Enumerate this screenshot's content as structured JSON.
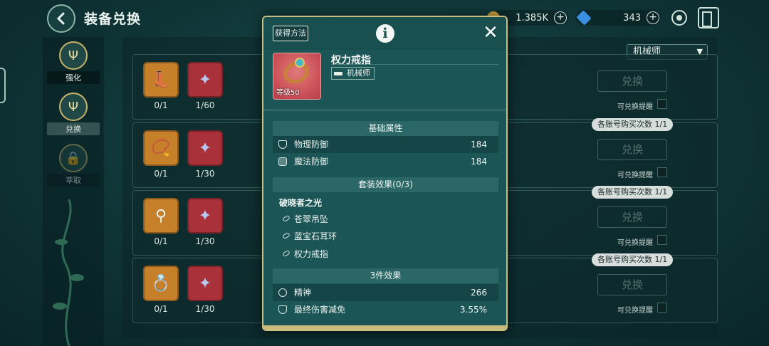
{
  "page": {
    "title": "装备兑换",
    "currency_gold": "1.385K",
    "currency_gem": "343",
    "class_filter": "机械师"
  },
  "side_nav": [
    {
      "label": "强化"
    },
    {
      "label": "兑换"
    },
    {
      "label": "萃取"
    }
  ],
  "rows": [
    {
      "equip_count": "0/1",
      "mat_count": "1/60",
      "redeem_label": "兑换",
      "remind_label": "可兑换提醒",
      "limit_badge": ""
    },
    {
      "equip_count": "0/1",
      "mat_count": "1/30",
      "redeem_label": "兑换",
      "remind_label": "可兑换提醒",
      "limit_badge": "各账号购买次数 1/1"
    },
    {
      "equip_count": "0/1",
      "mat_count": "1/30",
      "redeem_label": "兑换",
      "remind_label": "可兑换提醒",
      "limit_badge": "各账号购买次数 1/1"
    },
    {
      "equip_count": "0/1",
      "mat_count": "1/30",
      "redeem_label": "兑换",
      "remind_label": "可兑换提醒",
      "limit_badge": "各账号购买次数 1/1"
    }
  ],
  "modal": {
    "obtain_label": "获得方法",
    "info_glyph": "i",
    "close_glyph": "✕",
    "item_name": "权力戒指",
    "item_class": "机械师",
    "item_level": "等级50",
    "base_title": "基础属性",
    "base_attrs": [
      {
        "name": "物理防御",
        "value": "184"
      },
      {
        "name": "魔法防御",
        "value": "184"
      }
    ],
    "set_title": "套装效果(0/3)",
    "set_name": "破晓者之光",
    "set_pieces": [
      "苍翠吊坠",
      "蓝宝石耳环",
      "权力戒指"
    ],
    "bonus_title": "3件效果",
    "bonus_attrs": [
      {
        "name": "精神",
        "value": "266"
      },
      {
        "name": "最终伤害减免",
        "value": "3.55%"
      }
    ]
  },
  "colors": {
    "modal_bg": "#1c5556",
    "modal_border": "#cbbd7d",
    "section_header": "#2b6767",
    "item_rarity_bg": "#c94d55"
  },
  "icons": {
    "back": "back-arrow-icon",
    "gold": "coin-icon",
    "gem": "gem-icon",
    "settings": "settings-icon",
    "exit": "exit-icon",
    "info": "info-icon",
    "close": "close-icon"
  }
}
